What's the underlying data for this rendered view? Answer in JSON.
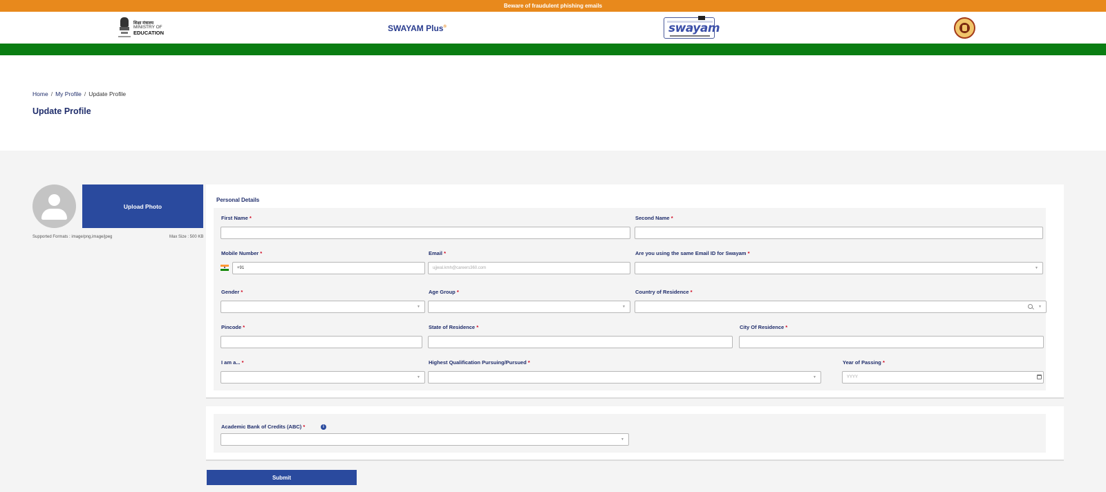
{
  "alert": {
    "text": "Beware of fraudulent phishing emails"
  },
  "header": {
    "moe": {
      "hindi": "शिक्षा मंत्रालय",
      "line1": "MINISTRY OF",
      "line2": "EDUCATION"
    },
    "swayam_plus": {
      "text": "SWAYAM Plus",
      "mark": "®"
    },
    "swayam": {
      "text": "swayam"
    }
  },
  "breadcrumb": {
    "home": "Home",
    "profile": "My Profile",
    "current": "Update Profile",
    "sep": "/"
  },
  "page_title": "Update Profile",
  "photo": {
    "upload_label": "Upload Photo",
    "formats": "Supported Formats : image/png,image/jpeg",
    "max_size": "Max Size : 500 KB"
  },
  "personal": {
    "section_title": "Personal Details",
    "first_name": {
      "label": "First Name",
      "value": ""
    },
    "second_name": {
      "label": "Second Name",
      "value": ""
    },
    "mobile": {
      "label": "Mobile Number",
      "value": "+91"
    },
    "email": {
      "label": "Email",
      "value": "ujjwal.kmh@careers360.com"
    },
    "same_email": {
      "label": "Are you using the same Email ID for Swayam",
      "value": ""
    },
    "gender": {
      "label": "Gender",
      "value": ""
    },
    "age_group": {
      "label": "Age Group",
      "value": ""
    },
    "country": {
      "label": "Country of Residence",
      "value": ""
    },
    "pincode": {
      "label": "Pincode",
      "value": ""
    },
    "state": {
      "label": "State of Residence",
      "value": ""
    },
    "city": {
      "label": "City Of Residence",
      "value": ""
    },
    "i_am": {
      "label": "I am a...",
      "value": ""
    },
    "qualification": {
      "label": "Highest Qualification Pursuing/Pursued",
      "value": ""
    },
    "year_passing": {
      "label": "Year of Passing",
      "placeholder": "YYYY"
    },
    "required_mark": "*"
  },
  "abc": {
    "label": "Academic Bank of Credits (ABC)",
    "value": "",
    "info": "i"
  },
  "submit_label": "Submit",
  "colors": {
    "primary": "#2a4a9e",
    "saffron": "#e8891c",
    "green": "#0a7d12",
    "required": "#d0021b"
  }
}
